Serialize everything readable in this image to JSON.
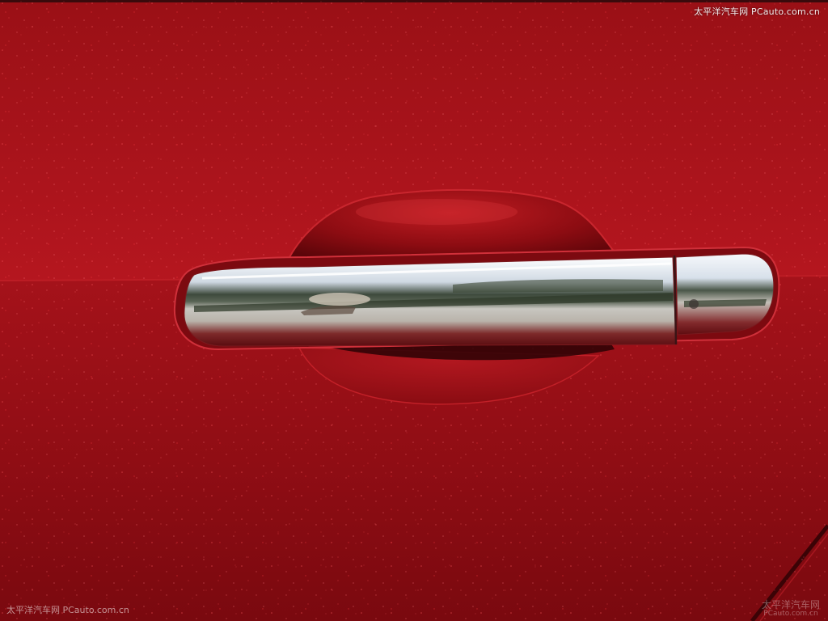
{
  "photo": {
    "watermark_top": "太平洋汽车网 PCauto.com.cn",
    "watermark_bottom_left": "太平洋汽车网 PCauto.com.cn",
    "watermark_bottom_right_logo": "太平洋汽车网",
    "watermark_bottom_right_url": "PCauto.com.cn"
  },
  "colors": {
    "body_paint": "#9c1118",
    "body_paint_upper": "#a8141c",
    "body_paint_shadow": "#6a070c",
    "chrome_light": "#f4f6f8",
    "chrome_dark": "#5a5e62"
  }
}
